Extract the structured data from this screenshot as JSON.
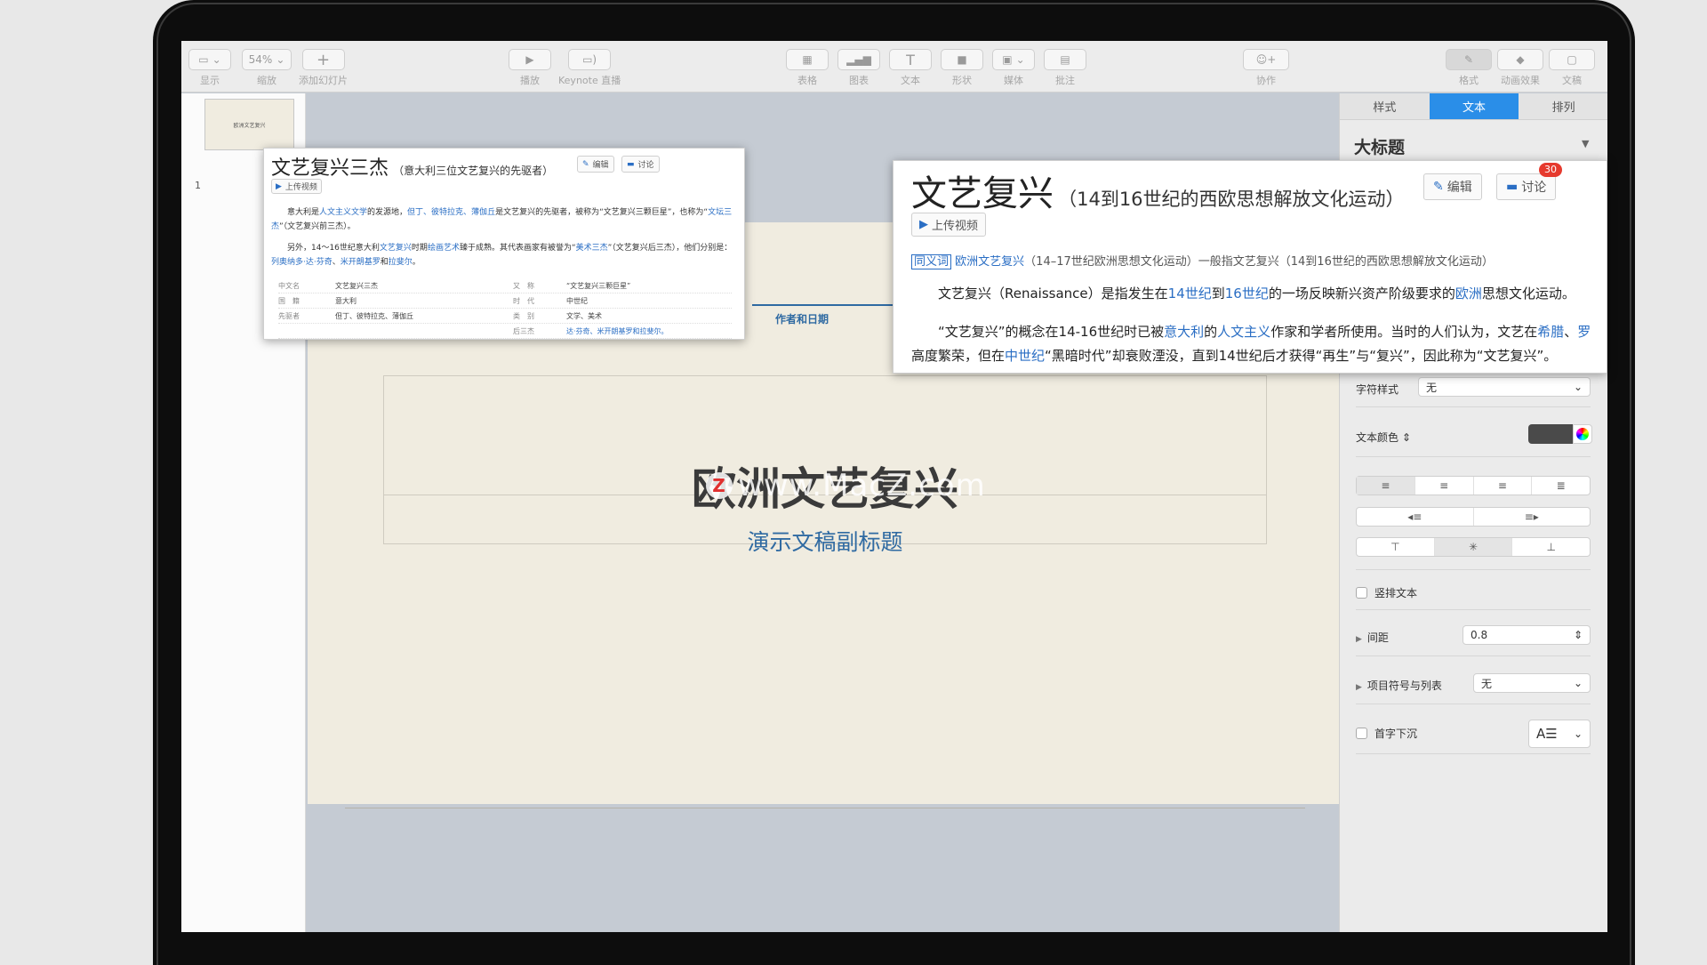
{
  "toolbar": {
    "view_label": "显示",
    "zoom_value": "54%",
    "zoom_label": "缩放",
    "add_slide_label": "添加幻灯片",
    "play_label": "播放",
    "keynote_live_label": "Keynote 直播",
    "table_label": "表格",
    "chart_label": "图表",
    "text_label": "文本",
    "shape_label": "形状",
    "media_label": "媒体",
    "comment_label": "批注",
    "collaborate_label": "协作",
    "format_label": "格式",
    "animate_label": "动画效果",
    "document_label": "文稿"
  },
  "navigator": {
    "thumb_text": "欧洲文艺复兴",
    "slide_number": "1"
  },
  "slide": {
    "author_text": "作者和日期",
    "title": "欧洲文艺复兴",
    "subtitle": "演示文稿副标题",
    "watermark_logo": "Z",
    "watermark_text": "www.MacZ.com"
  },
  "inspector": {
    "tabs": [
      "样式",
      "文本",
      "排列"
    ],
    "active_tab": "文本",
    "style_heading": "大标题",
    "char_style_label": "字符样式",
    "char_style_value": "无",
    "text_color_label": "文本颜色",
    "text_color_swatch": "#4a4a4a",
    "vertical_text_label": "竖排文本",
    "spacing_label": "间距",
    "spacing_value": "0.8",
    "bullets_label": "项目符号与列表",
    "bullets_value": "无",
    "drop_cap_label": "首字下沉"
  },
  "popup_small": {
    "title": "文艺复兴三杰",
    "subtitle": "（意大利三位文艺复兴的先驱者）",
    "edit_label": "编辑",
    "discuss_label": "讨论",
    "upload_label": "上传视频",
    "para1_a": "意大利是",
    "para1_link1": "人文主义文学",
    "para1_b": "的发源地，",
    "para1_link2": "但丁、彼特拉克、薄伽丘",
    "para1_c": "是文艺复兴的先驱者，被称为“文艺复兴三颗巨星”，也称为“",
    "para1_link3": "文坛三杰",
    "para1_d": "”（文艺复兴前三杰）。",
    "para2_a": "另外，14～16世纪意大利",
    "para2_link1": "文艺复兴",
    "para2_b": "时期",
    "para2_link2": "绘画艺术",
    "para2_c": "臻于成熟。其代表画家有被誉为“",
    "para2_link3": "美术三杰",
    "para2_d": "”（文艺复兴后三杰），他们分别是：",
    "para2_link4": "列奥纳多·达·芬奇",
    "para2_e": "、",
    "para2_link5": "米开朗基罗",
    "para2_f": "和",
    "para2_link6": "拉斐尔",
    "para2_g": "。",
    "table": [
      [
        "中文名",
        "文艺复兴三杰",
        "又　称",
        "“文艺复兴三颗巨星”"
      ],
      [
        "国　籍",
        "意大利",
        "时　代",
        "中世纪"
      ],
      [
        "先驱者",
        "但丁、彼特拉克、薄伽丘",
        "类　别",
        "文学、美术"
      ],
      [
        "",
        "",
        "后三杰",
        "达·芬奇、米开朗基罗和拉斐尔。"
      ]
    ]
  },
  "popup_large": {
    "title": "文艺复兴",
    "subtitle": "（14到16世纪的西欧思想解放文化运动）",
    "edit_label": "编辑",
    "discuss_label": "讨论",
    "discuss_count": "30",
    "upload_label": "上传视频",
    "synonym_tag": "同义词",
    "synonym_link": "欧洲文艺复兴",
    "synonym_rest": "（14–17世纪欧洲思想文化运动）一般指文艺复兴（14到16世纪的西欧思想解放文化运动）",
    "p1_a": "文艺复兴（Renaissance）是指发生在",
    "p1_link1": "14世纪",
    "p1_b": "到",
    "p1_link2": "16世纪",
    "p1_c": "的一场反映新兴资产阶级要求的",
    "p1_link3": "欧洲",
    "p1_d": "思想文化运动。",
    "p2_a": "“文艺复兴”的概念在14-16世纪时已被",
    "p2_link1": "意大利",
    "p2_b": "的",
    "p2_link2": "人文主义",
    "p2_c": "作家和学者所使用。当时的人们认为，文艺在",
    "p2_link3": "希腊",
    "p2_d": "、",
    "p2_link4": "罗",
    "p3_a": "高度繁荣，但在",
    "p3_link1": "中世纪",
    "p3_b": "“黑暗时代”却衰败湮没，直到14世纪后才获得“再生”与“复兴”，因此称为“文艺复兴”。"
  }
}
